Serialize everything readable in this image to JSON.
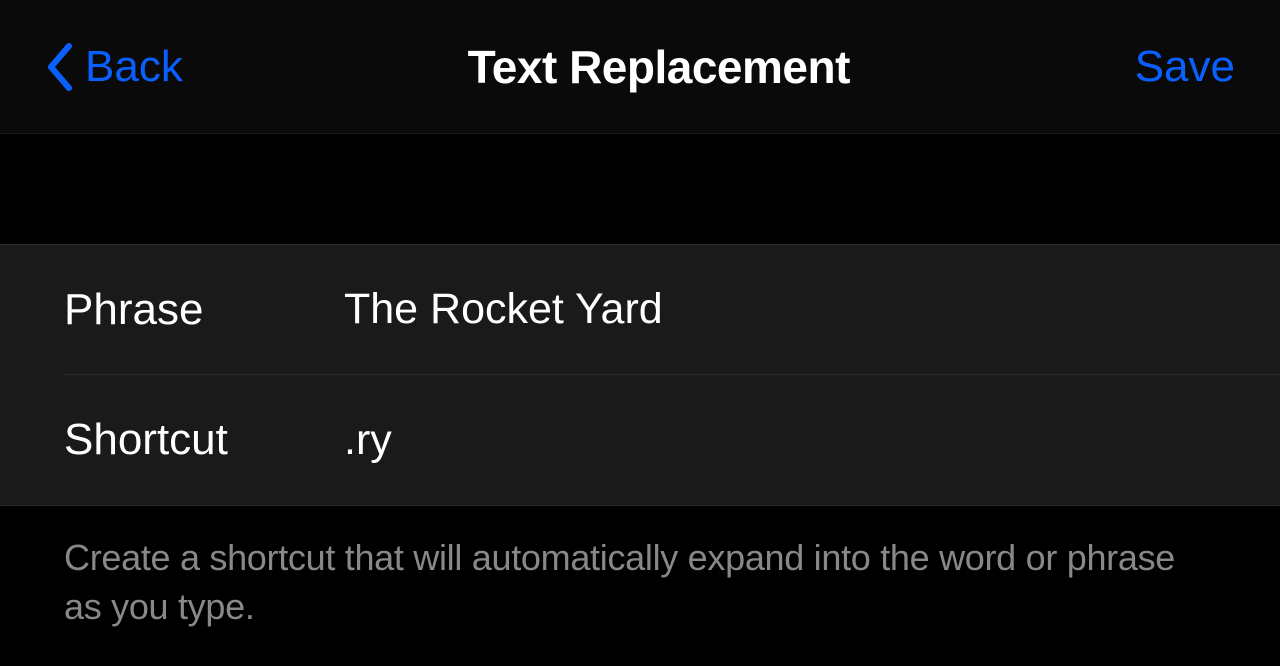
{
  "nav": {
    "back_label": "Back",
    "title": "Text Replacement",
    "save_label": "Save"
  },
  "form": {
    "phrase_label": "Phrase",
    "phrase_value": "The Rocket Yard",
    "shortcut_label": "Shortcut",
    "shortcut_value": ".ry"
  },
  "footer": {
    "text": "Create a shortcut that will automatically expand into the word or phrase as you type."
  }
}
